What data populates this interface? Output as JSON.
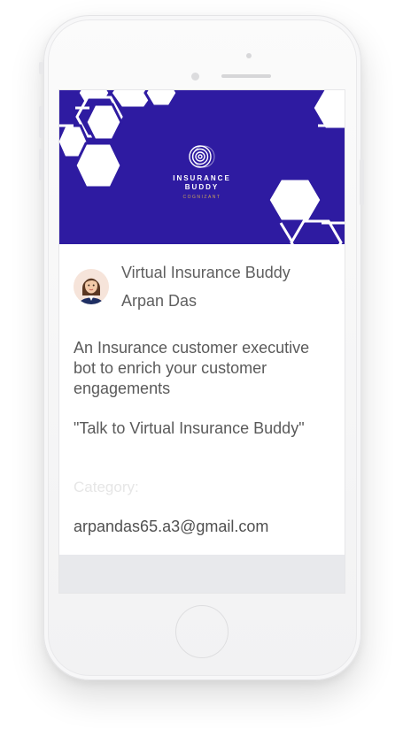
{
  "banner": {
    "logo_line1": "INSURANCE",
    "logo_line2": "BUDDY",
    "logo_line3": "COGNIZANT",
    "colors": {
      "background": "#2e1ba1",
      "hexagon": "#ffffff"
    }
  },
  "app": {
    "title": "Virtual Insurance Buddy",
    "author": "Arpan Das",
    "description": "An Insurance customer executive bot to enrich your customer engagements",
    "invocation": "\"Talk to Virtual Insurance Buddy\"",
    "category_label": "Category:",
    "email": "arpandas65.a3@gmail.com"
  },
  "icons": {
    "logo": "concentric-circles-logo-icon",
    "avatar": "woman-avatar"
  }
}
